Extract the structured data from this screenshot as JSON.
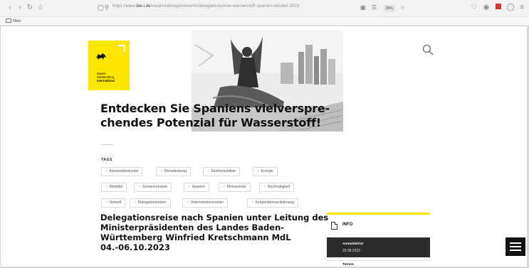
{
  "browser": {
    "url_prefix": "https://www.",
    "url_domain": "bw-i.de",
    "url_path": "/veranstaltungen/events/delegationsreise-wasserstoff-spanien-oktober-2023",
    "zoom": "80%",
    "bookmark": "Neu"
  },
  "logo": {
    "line1": "Baden-",
    "line2": "Württemberg",
    "line3": "International"
  },
  "headline": "Entdecken Sie Spaniens vielverspre-chendes Potenzial für Wasserstoff!",
  "tags": {
    "label": "TAGS",
    "items": [
      "Automobilindustrie",
      "Dienstleistung",
      "Elektromobilität",
      "Energie",
      "Mobilität",
      "Schwerindustrie",
      "Spanien",
      "Klimaschutz",
      "Nachhaltigkeit",
      "Umwelt",
      "Delegationsreisen",
      "Unternehmensreisen",
      "Kooperationsanbahnung"
    ]
  },
  "article_title": "Delegationsreise nach Spanien unter Leitung des Ministerpräsidenten des Landes Baden-Württemberg Winfried Kretschmann MdL 04.-06.10.2023",
  "info": {
    "heading": "INFO",
    "deadline_label": "Anmeldefrist",
    "deadline_value": "20.08.2023",
    "next_label": "Termin"
  },
  "colors": {
    "brand_yellow": "#ffe600",
    "dark": "#2c2c2c"
  }
}
